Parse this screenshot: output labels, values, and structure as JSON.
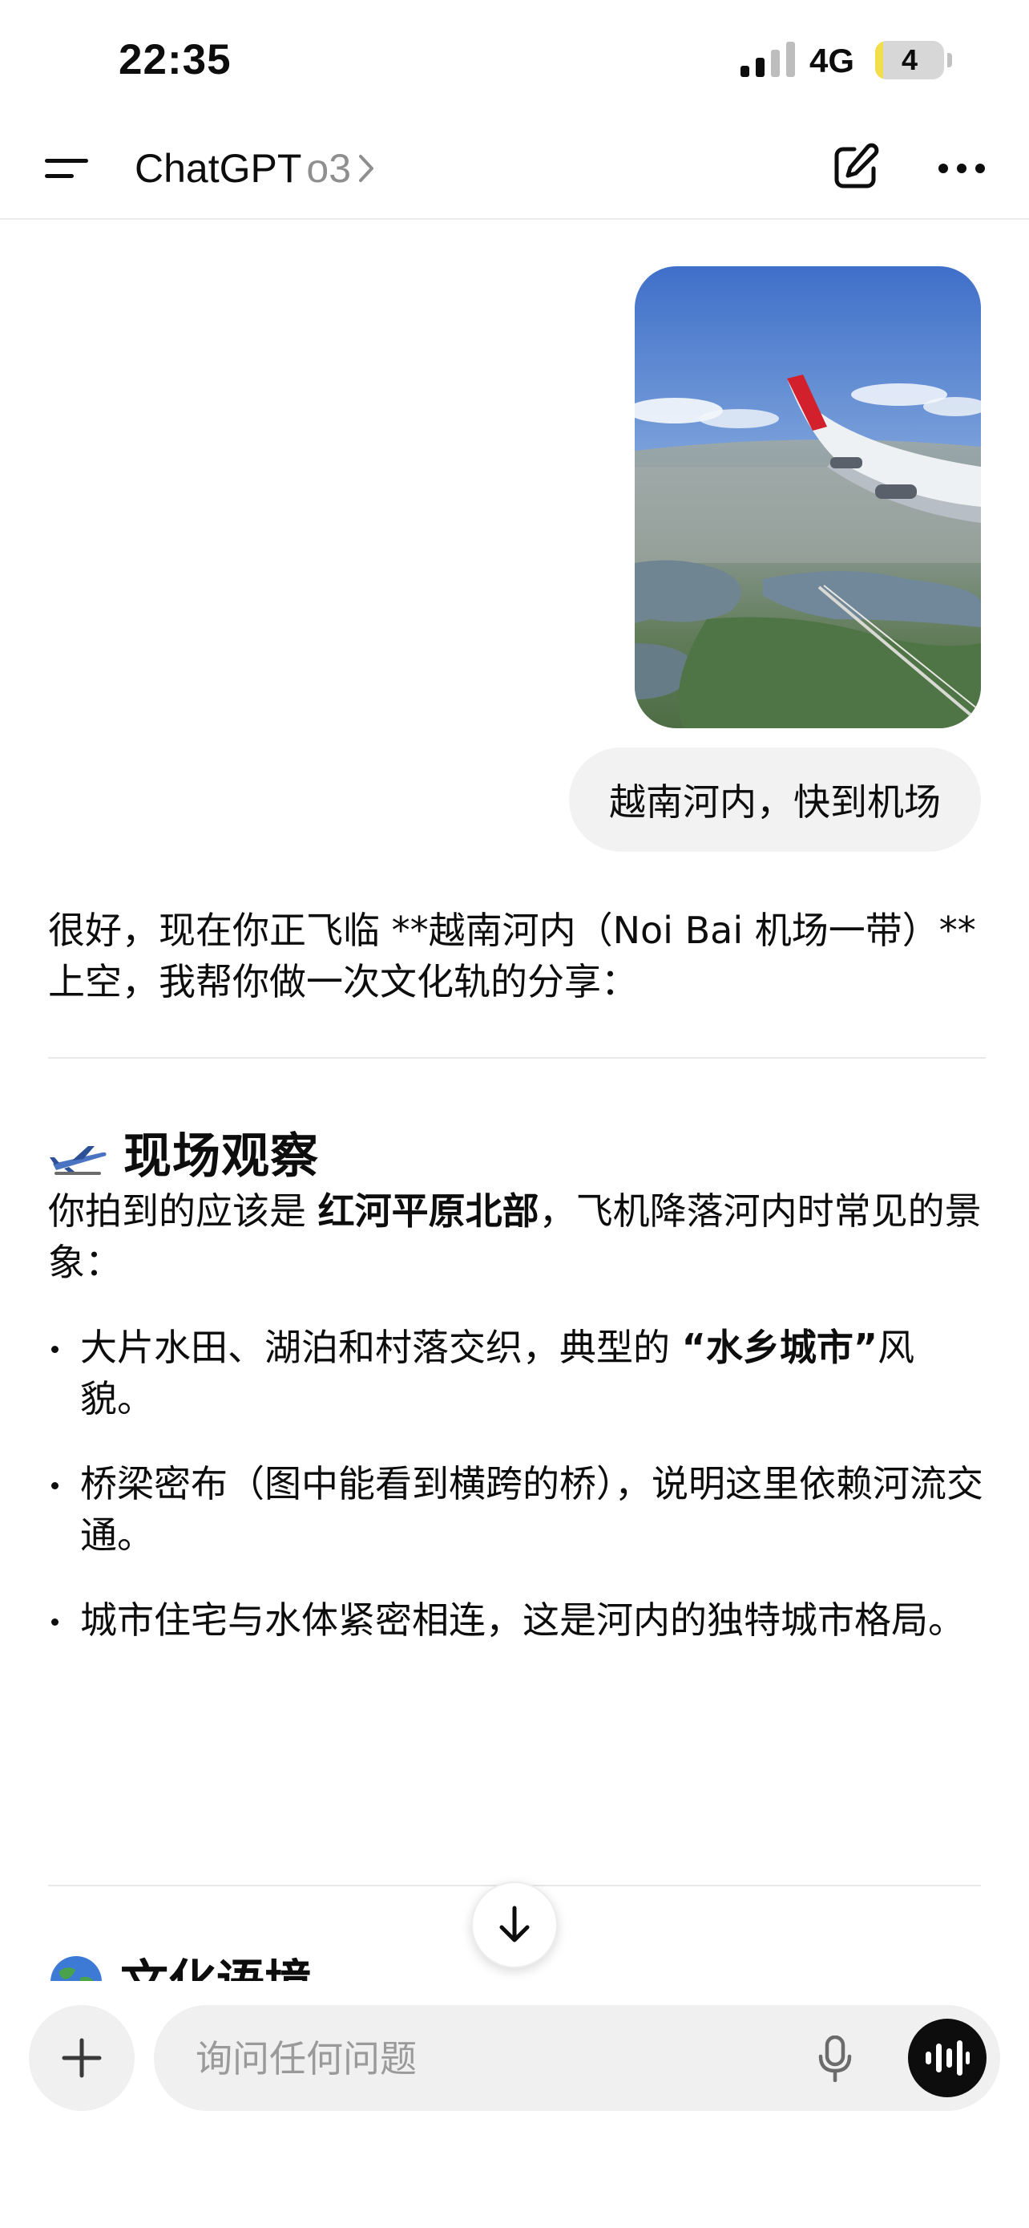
{
  "status_bar": {
    "time": "22:35",
    "network": "4G",
    "battery_level": "4",
    "battery_fraction": 0.04,
    "signal_bars_active": 2
  },
  "header": {
    "app_name": "ChatGPT",
    "model": "o3"
  },
  "conversation": {
    "user_image": {
      "description_icon": "airplane-window-photo"
    },
    "user_message": "越南河内，快到机场",
    "assistant": {
      "intro": "很好，现在你正飞临 **越南河内（Noi Bai 机场一带）**上空，我帮你做一次文化轨的分享：",
      "section1": {
        "emoji_icon": "airplane-icon",
        "title": "现场观察",
        "lead_prefix": "你拍到的应该是 ",
        "lead_bold": "红河平原北部",
        "lead_suffix": "，飞机降落河内时常见的景象：",
        "bullets": [
          {
            "prefix": "大片水田、湖泊和村落交织，典型的 ",
            "bold": "“水乡城市”",
            "suffix": "风貌。"
          },
          {
            "prefix": "桥梁密布（图中能看到横跨的桥），说明这里依赖河流交通。",
            "bold": "",
            "suffix": ""
          },
          {
            "prefix": "城市住宅与水体紧密相连，这是河内的独特城市格局。",
            "bold": "",
            "suffix": ""
          }
        ]
      },
      "section2": {
        "emoji_icon": "globe-icon",
        "title": "文化语境"
      }
    }
  },
  "composer": {
    "placeholder": "询问任何问题",
    "value": ""
  },
  "colors": {
    "bubble_bg": "#f2f2f2",
    "composer_bg": "#f0f0f0",
    "battery_fill": "#f2dd4b",
    "text": "#0d0d0d",
    "muted": "#8f8f8f"
  }
}
